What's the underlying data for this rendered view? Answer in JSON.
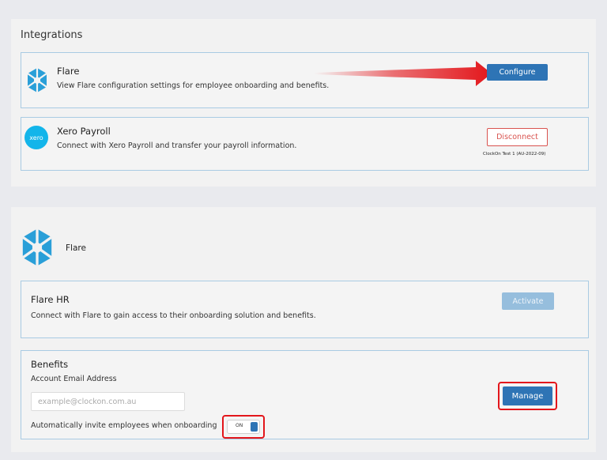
{
  "integrations": {
    "title": "Integrations",
    "flare": {
      "name": "Flare",
      "description": "View Flare configuration settings for employee onboarding and benefits.",
      "configure_label": "Configure",
      "icon": "flare-logo-icon"
    },
    "xero": {
      "name": "Xero Payroll",
      "description": "Connect with Xero Payroll and transfer your payroll information.",
      "disconnect_label": "Disconnect",
      "connection_note": "ClockOn Test 1 (AU-2022-09)",
      "logo_text": "xero"
    }
  },
  "flare_panel": {
    "title": "Flare",
    "flare_hr": {
      "title": "Flare HR",
      "description": "Connect with Flare to gain access to their onboarding solution and benefits.",
      "activate_label": "Activate"
    },
    "benefits": {
      "title": "Benefits",
      "email_label": "Account Email Address",
      "email_placeholder": "example@clockon.com.au",
      "email_value": "",
      "auto_invite_label": "Automatically invite employees when onboarding",
      "toggle_state": "ON",
      "manage_label": "Manage"
    }
  },
  "colors": {
    "primary": "#2e74b5",
    "disabled": "#96bedd",
    "danger": "#d9534f",
    "highlight": "#e3161b",
    "flare_blue": "#2a9fd8",
    "xero_blue": "#13b5ea",
    "card_border": "#a9cbe3"
  }
}
